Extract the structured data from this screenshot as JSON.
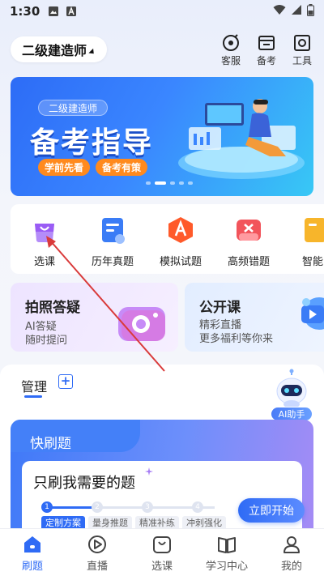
{
  "status_bar": {
    "time": "1:30"
  },
  "header": {
    "exam_selector": "二级建造师",
    "tools": [
      {
        "label": "客服",
        "icon": "customer-service-icon"
      },
      {
        "label": "备考",
        "icon": "calendar-icon"
      },
      {
        "label": "工具",
        "icon": "toolbox-icon"
      }
    ]
  },
  "banner": {
    "tag": "二级建造师",
    "headline": "备考指导",
    "pill_left": "学前先看",
    "pill_right": "备考有策"
  },
  "quick_access": [
    {
      "label": "选课",
      "icon": "shopping-bag-icon",
      "color": "#9a5cf5"
    },
    {
      "label": "历年真题",
      "icon": "document-icon",
      "color": "#3a7cf6"
    },
    {
      "label": "模拟试题",
      "icon": "exam-a-icon",
      "color": "#ff5a2a"
    },
    {
      "label": "高频错题",
      "icon": "wrong-answer-icon",
      "color": "#f2545b"
    },
    {
      "label": "智能",
      "icon": "smart-icon",
      "color": "#f7b52b"
    }
  ],
  "feature_cards": {
    "photo": {
      "title": "拍照答疑",
      "line1": "AI答疑",
      "line2": "随时提问"
    },
    "live": {
      "title": "公开课",
      "line1": "精彩直播",
      "line2": "更多福利等你来"
    }
  },
  "manage": {
    "label": "管理",
    "add_symbol": "+",
    "ai_helper": "AI助手"
  },
  "practice": {
    "title": "快刷题",
    "subtitle": "只刷我需要的题",
    "steps": [
      "1",
      "2",
      "3",
      "4"
    ],
    "step_labels": [
      "定制方案",
      "量身推题",
      "精准补练",
      "冲刺强化"
    ],
    "start_button": "立即开始"
  },
  "bottom_nav": [
    {
      "label": "刷题",
      "icon": "home-icon",
      "active": true
    },
    {
      "label": "直播",
      "icon": "play-icon",
      "active": false
    },
    {
      "label": "选课",
      "icon": "course-bag-icon",
      "active": false
    },
    {
      "label": "学习中心",
      "icon": "book-icon",
      "active": false
    },
    {
      "label": "我的",
      "icon": "user-icon",
      "active": false
    }
  ],
  "colors": {
    "primary": "#2f6bf5",
    "annotation_arrow": "#d93a3a"
  }
}
